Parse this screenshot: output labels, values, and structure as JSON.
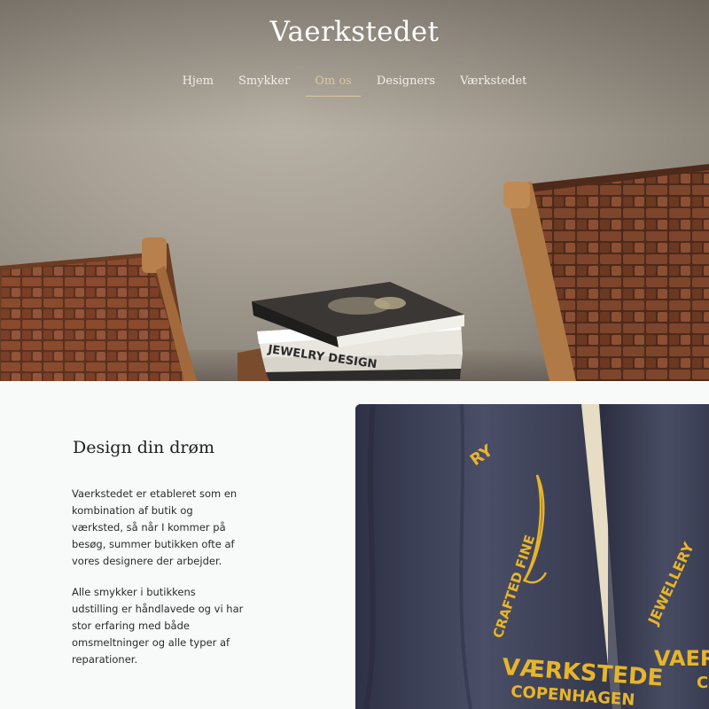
{
  "header": {
    "site_title": "Vaerkstedet",
    "nav": [
      {
        "label": "Hjem",
        "active": false
      },
      {
        "label": "Smykker",
        "active": false
      },
      {
        "label": "Om os",
        "active": true
      },
      {
        "label": "Designers",
        "active": false
      },
      {
        "label": "Værkstedet",
        "active": false
      }
    ]
  },
  "hero": {
    "book_spine_text": "JEWELRY DESIGN"
  },
  "about": {
    "title": "Design din drøm",
    "paragraphs": [
      "Vaerkstedet er etableret som en kombination af butik og værksted, så når I kommer på besøg, summer butikken ofte af vores designere der arbejder.",
      "Alle smykker i butikkens udstilling er håndlavede og vi har stor erfaring med både omsmeltninger og alle typer af reparationer."
    ]
  },
  "photo": {
    "apron_text_left_1": "VÆRKSTEDE",
    "apron_text_left_2": "COPENHAGEN",
    "apron_text_left_arc": "CRAFTED FINE",
    "apron_text_left_arc_top": "RY",
    "apron_text_right_1": "VAERKS",
    "apron_text_right_2": "CO",
    "apron_text_right_arc": "JEWELLERY",
    "accent_color": "#e7b52b"
  },
  "colors": {
    "nav_active": "#d9c7a2",
    "body_bg": "#f8faf9",
    "apron_blue": "#3f4358"
  }
}
